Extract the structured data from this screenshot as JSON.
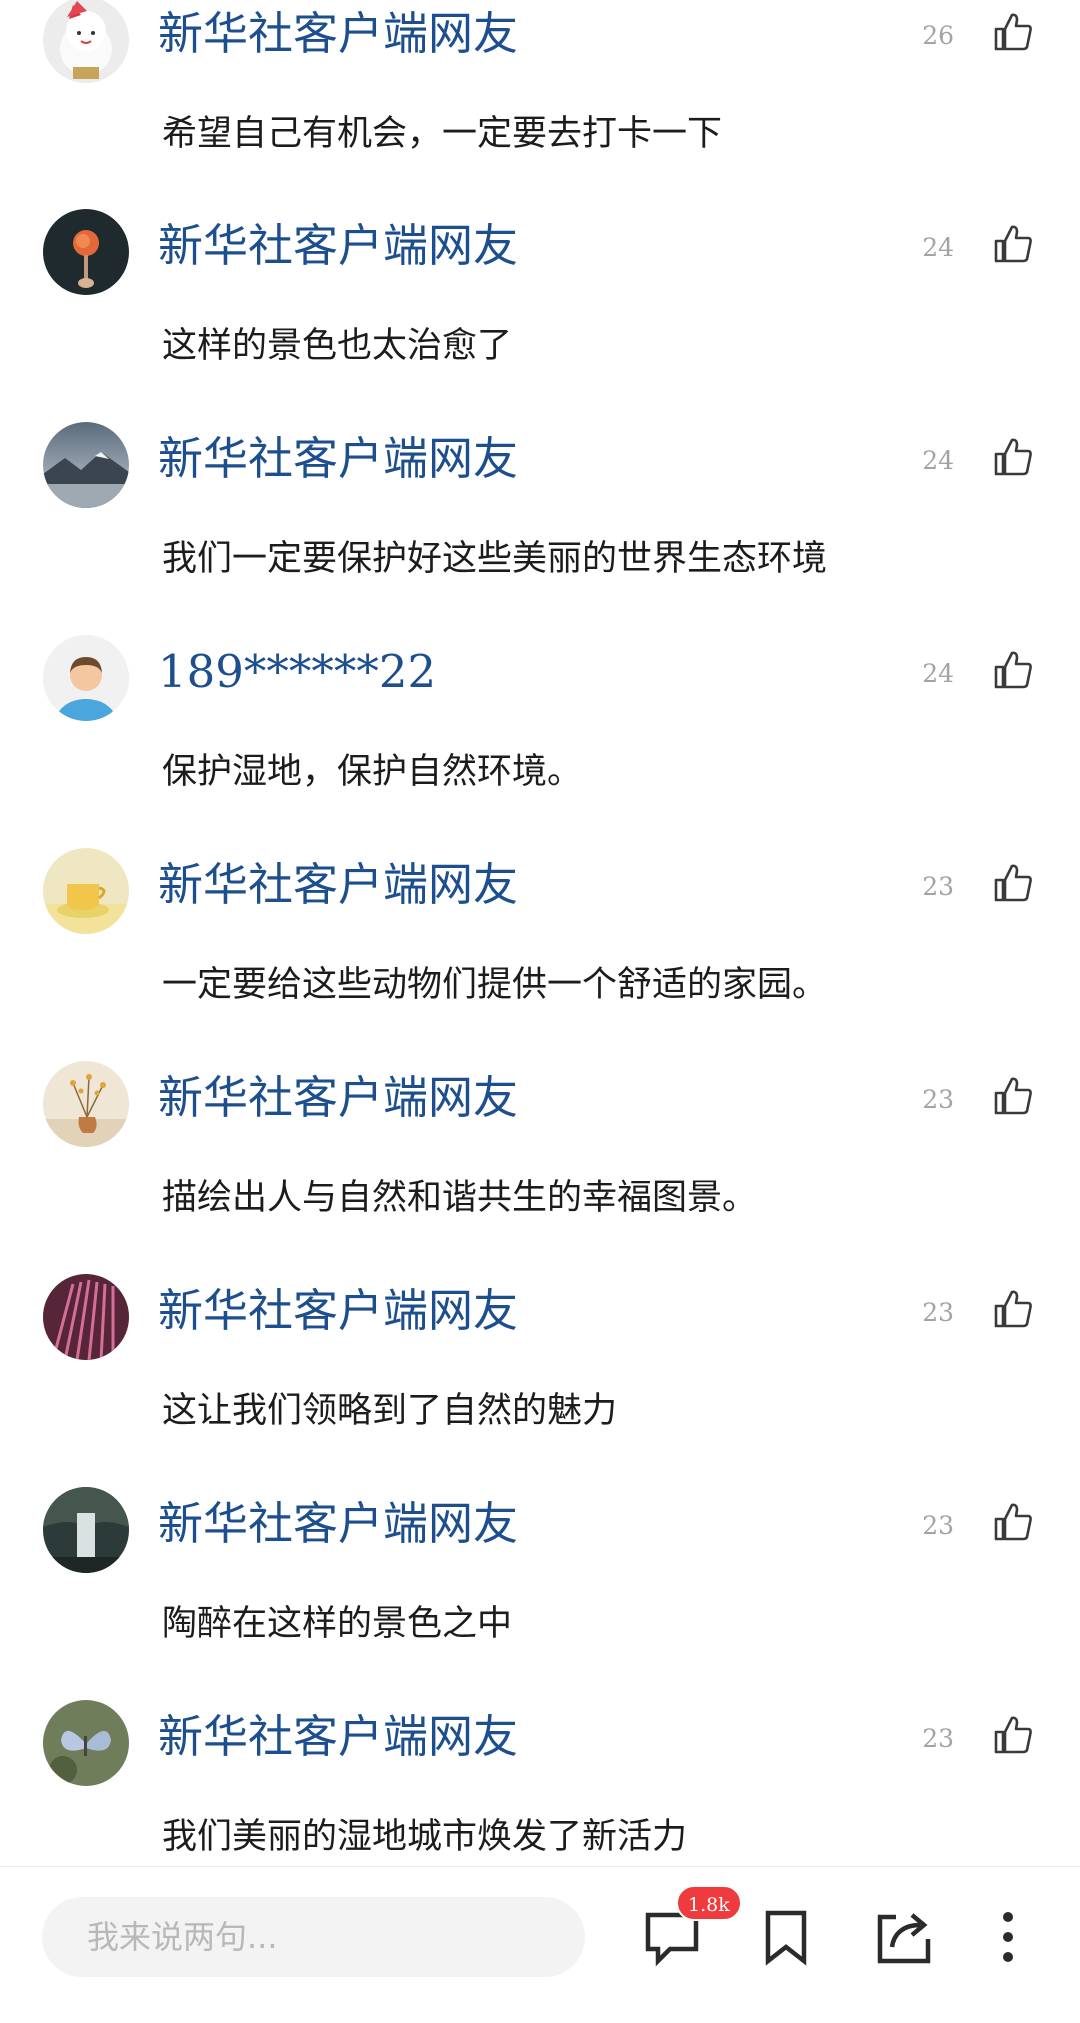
{
  "comments": [
    {
      "username": "新华社客户端网友",
      "likes": "26",
      "text": "希望自己有机会，一定要去打卡一下",
      "avatar": "lucky-cat-avatar"
    },
    {
      "username": "新华社客户端网友",
      "likes": "24",
      "text": "这样的景色也太治愈了",
      "avatar": "rose-avatar"
    },
    {
      "username": "新华社客户端网友",
      "likes": "24",
      "text": "我们一定要保护好这些美丽的世界生态环境",
      "avatar": "snowy-mountain-avatar"
    },
    {
      "username": "189******22",
      "likes": "24",
      "text": "保护湿地，保护自然环境。",
      "avatar": "default-person-avatar"
    },
    {
      "username": "新华社客户端网友",
      "likes": "23",
      "text": "一定要给这些动物们提供一个舒适的家园。",
      "avatar": "teacup-avatar"
    },
    {
      "username": "新华社客户端网友",
      "likes": "23",
      "text": "描绘出人与自然和谐共生的幸福图景。",
      "avatar": "flower-vase-avatar"
    },
    {
      "username": "新华社客户端网友",
      "likes": "23",
      "text": "这让我们领略到了自然的魅力",
      "avatar": "pink-lights-avatar"
    },
    {
      "username": "新华社客户端网友",
      "likes": "23",
      "text": "陶醉在这样的景色之中",
      "avatar": "waterfall-avatar"
    },
    {
      "username": "新华社客户端网友",
      "likes": "23",
      "text": "我们美丽的湿地城市焕发了新活力",
      "avatar": "butterfly-avatar"
    }
  ],
  "bottom_bar": {
    "input_placeholder": "我来说两句...",
    "comment_count_badge": "1.8k",
    "icons": [
      "comment-icon",
      "bookmark-icon",
      "share-icon",
      "more-icon"
    ]
  },
  "colors": {
    "username": "#1d4f8f",
    "like_count": "#a3a3a3",
    "comment_text": "#1c1c1c",
    "badge": "#ef3a3e",
    "icon": "#2b2b2b"
  }
}
